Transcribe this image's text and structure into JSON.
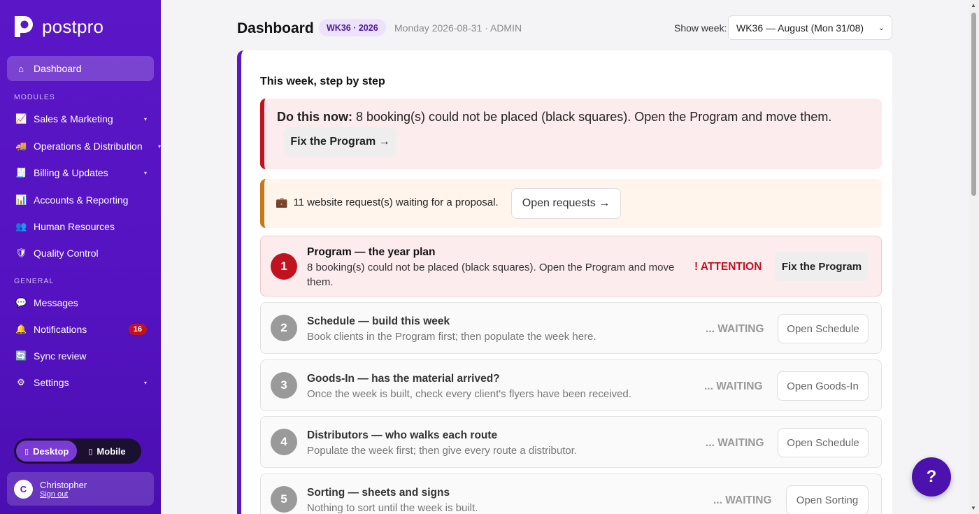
{
  "app": {
    "name": "postpro"
  },
  "sidebar": {
    "dashboard": {
      "label": "Dashboard",
      "icon": "home-icon"
    },
    "modules_label": "MODULES",
    "modules": [
      {
        "label": "Sales & Marketing",
        "icon": "chart-icon",
        "has_caret": true
      },
      {
        "label": "Operations & Distribution",
        "icon": "truck-icon",
        "has_caret": true
      },
      {
        "label": "Billing & Updates",
        "icon": "receipt-icon",
        "has_caret": true
      },
      {
        "label": "Accounts & Reporting",
        "icon": "bar-chart-icon",
        "has_caret": false
      },
      {
        "label": "Human Resources",
        "icon": "people-icon",
        "has_caret": false
      },
      {
        "label": "Quality Control",
        "icon": "shield-icon",
        "has_caret": false
      }
    ],
    "general_label": "GENERAL",
    "general": [
      {
        "label": "Messages",
        "icon": "speech-bubble-icon"
      },
      {
        "label": "Notifications",
        "icon": "bell-icon",
        "badge": "16"
      },
      {
        "label": "Sync review",
        "icon": "sync-icon"
      },
      {
        "label": "Settings",
        "icon": "gear-icon"
      }
    ],
    "mode": {
      "desktop": "Desktop",
      "mobile": "Mobile",
      "selected": "Desktop"
    },
    "user": {
      "initial": "C",
      "name": "Christopher",
      "signout": "Sign out"
    }
  },
  "header": {
    "title": "Dashboard",
    "week_pill": "WK36 · 2026",
    "meta": "Monday 2026-08-31 · ADMIN",
    "show_week_label": "Show week:",
    "week_select_value": "WK36 — August (Mon 31/08)"
  },
  "card": {
    "heading": "This week, step by step",
    "urgent": {
      "lead": "Do this now:",
      "text": " 8 booking(s) could not be placed (black squares). Open the Program and move them.",
      "button": "Fix the Program →"
    },
    "requests": {
      "icon": "briefcase-icon",
      "text": "11 website request(s) waiting for a proposal.",
      "button": "Open requests →"
    },
    "steps": [
      {
        "num": "1",
        "title": "Program — the year plan",
        "desc": "8 booking(s) could not be placed (black squares). Open the Program and move them.",
        "status": "! ATTENTION",
        "button": "Fix the Program",
        "attention": true
      },
      {
        "num": "2",
        "title": "Schedule — build this week",
        "desc": "Book clients in the Program first; then populate the week here.",
        "status": "... WAITING",
        "button": "Open Schedule",
        "attention": false
      },
      {
        "num": "3",
        "title": "Goods-In — has the material arrived?",
        "desc": "Once the week is built, check every client's flyers have been received.",
        "status": "... WAITING",
        "button": "Open Goods-In",
        "attention": false
      },
      {
        "num": "4",
        "title": "Distributors — who walks each route",
        "desc": "Populate the week first; then give every route a distributor.",
        "status": "... WAITING",
        "button": "Open Schedule",
        "attention": false
      },
      {
        "num": "5",
        "title": "Sorting — sheets and signs",
        "desc": "Nothing to sort until the week is built.",
        "status": "... WAITING",
        "button": "Open Sorting",
        "attention": false
      }
    ]
  },
  "help": {
    "label": "?"
  },
  "colors": {
    "accent": "#5b17c7",
    "danger": "#c1121f",
    "warning": "#c47a1a"
  }
}
